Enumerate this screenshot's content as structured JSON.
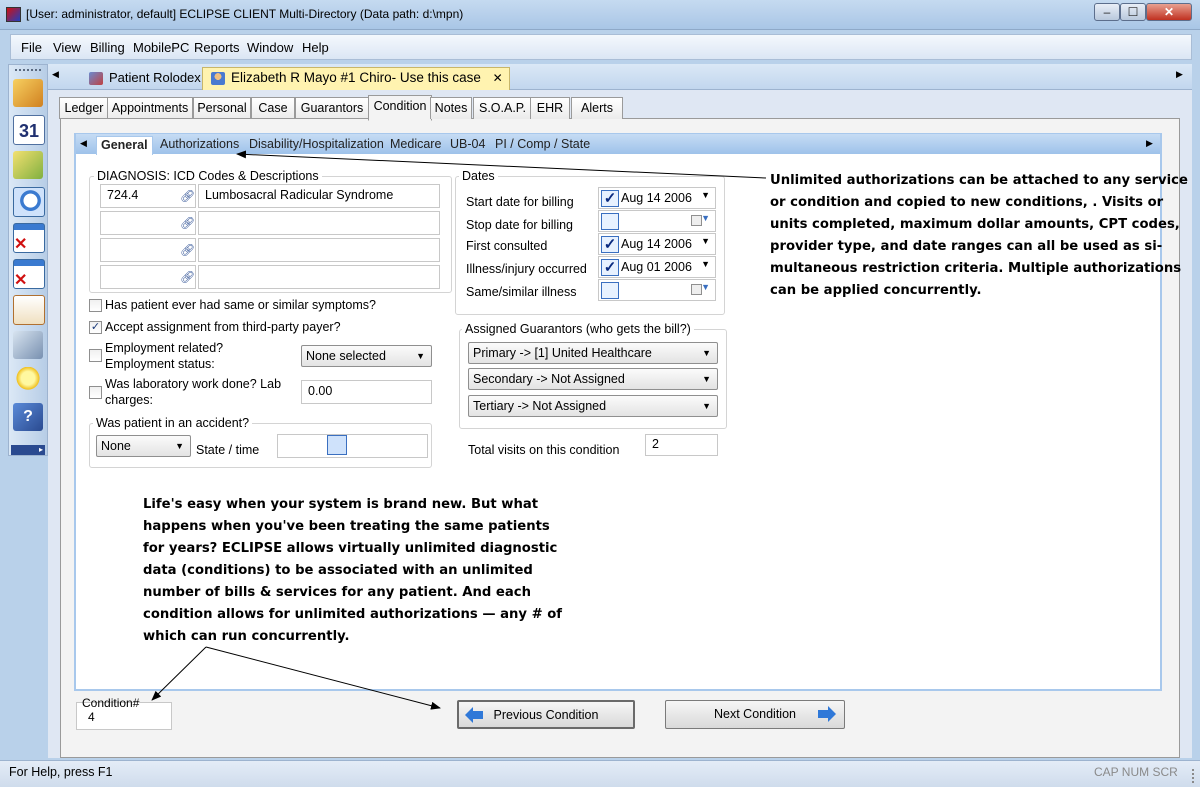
{
  "window": {
    "title": "[User: administrator, default]  ECLIPSE CLIENT Multi-Directory (Data path: d:\\mpn)",
    "minimize": "‒",
    "maximize": "☐",
    "close": "✕"
  },
  "menu": [
    "File",
    "View",
    "Billing",
    "MobilePC",
    "Reports",
    "Window",
    "Help"
  ],
  "doc_tabs": [
    {
      "label": "Patient Rolodex"
    },
    {
      "label": "Elizabeth R Mayo #1 Chiro- Use this case",
      "close": "✕"
    }
  ],
  "nav_arrows": {
    "left": "◀",
    "right": "▶"
  },
  "section_tabs": [
    "Ledger",
    "Appointments",
    "Personal",
    "Case",
    "Guarantors",
    "Condition",
    "Notes",
    "S.O.A.P.",
    "EHR",
    "Alerts"
  ],
  "condition_tabs": [
    "General",
    "Authorizations",
    "Disability/Hospitalization",
    "Medicare",
    "UB-04",
    "PI / Comp / State"
  ],
  "diagnosis": {
    "title": "DIAGNOSIS: ICD Codes & Descriptions",
    "rows": [
      {
        "code": "724.4",
        "description": "Lumbosacral Radicular Syndrome"
      },
      {
        "code": "",
        "description": ""
      },
      {
        "code": "",
        "description": ""
      },
      {
        "code": "",
        "description": ""
      }
    ]
  },
  "questions": {
    "similar_symptoms": {
      "label": "Has patient ever had same or similar symptoms?",
      "checked": false
    },
    "accept_assignment": {
      "label": "Accept assignment from third-party payer?",
      "checked": true
    },
    "employment_label1": "Employment related?",
    "employment_label2": "Employment status:",
    "employment_status": "None selected",
    "lab_label1": "Was laboratory work done?  Lab",
    "lab_label2": "charges:",
    "lab_charges": "0.00"
  },
  "accident": {
    "title": "Was patient in an accident?",
    "value": "None",
    "state_time_label": "State / time"
  },
  "dates": {
    "title": "Dates",
    "rows": [
      {
        "label": "Start date for billing",
        "checked": true,
        "value": "Aug 14 2006"
      },
      {
        "label": "Stop date for billing",
        "checked": false,
        "value": ""
      },
      {
        "label": "First consulted",
        "checked": true,
        "value": "Aug 14 2006"
      },
      {
        "label": "Illness/injury occurred",
        "checked": true,
        "value": "Aug 01 2006"
      },
      {
        "label": "Same/similar illness",
        "checked": false,
        "value": ""
      }
    ]
  },
  "guarantors": {
    "title": "Assigned Guarantors (who gets the bill?)",
    "primary": "Primary -> [1] United Healthcare",
    "secondary": "Secondary -> Not Assigned",
    "tertiary": "Tertiary -> Not Assigned"
  },
  "total_visits": {
    "label": "Total visits on this condition",
    "value": "2"
  },
  "condition_number": {
    "label": "Condition#",
    "value": "4"
  },
  "buttons": {
    "previous": "Previous Condition",
    "next": "Next Condition"
  },
  "annotations": {
    "authorizations_note": [
      "Unlimited authorizations can be attached to any service",
      "or condition and copied to new conditions, . Visits or",
      "units completed, maximum dollar amounts, CPT codes,",
      "provider type, and date ranges can all be used as si-",
      "multaneous restriction criteria. Multiple authorizations",
      "can be applied concurrently."
    ],
    "diagnostic_note": [
      "Life's easy when your system is brand new. But what",
      "happens when you've been treating the same patients",
      "for years? ECLIPSE allows virtually unlimited diagnostic",
      "data (conditions) to be associated with an unlimited",
      "number of bills & services for any patient. And each",
      "condition allows for unlimited authorizations — any # of",
      "which can run concurrently."
    ]
  },
  "status": {
    "help": "For Help, press F1",
    "indicators": "CAP NUM SCRL"
  },
  "colors": {
    "accent": "#a8c8ec",
    "active_doc_tab": "#fff3b0",
    "close_button": "#c03020",
    "nav_arrow": "#2f78d8"
  }
}
